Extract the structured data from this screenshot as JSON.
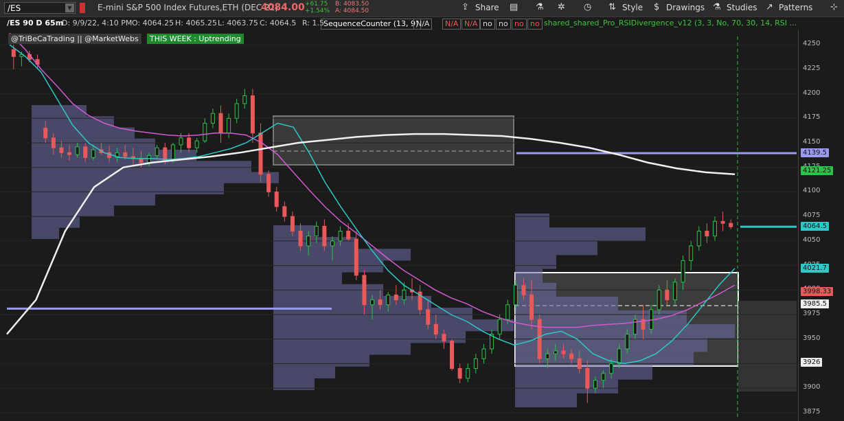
{
  "toolbar": {
    "symbol": "/ES",
    "description": "E-mini S&P 500 Index Futures,ETH (DEC 22)",
    "last_price": "4084.00",
    "change": "+61.75",
    "change_pct": "+1.54%",
    "bid": "B: 4083.50",
    "ask": "A: 4084.50",
    "share_label": "Share",
    "style_label": "Style",
    "drawings_label": "Drawings",
    "studies_label": "Studies",
    "patterns_label": "Patterns"
  },
  "infobar": {
    "period": "/ES 90 D 65m",
    "date": "D: 9/9/22, 4:10 PM",
    "open": "O: 4064.25",
    "high": "H: 4065.25",
    "low": "L: 4063.75",
    "close": "C: 4064.5",
    "range": "R: 1.5",
    "study1": "SequenceCounter (13, 9)",
    "vals": [
      "N/A",
      "N/A",
      "N/A",
      "no",
      "no",
      "no",
      "no"
    ],
    "study2": "shared_shared_Pro_RSIDivergence_v12 (3, 3, No, 70, 30, 14, RSI ..."
  },
  "badges": {
    "handles": "@TriBeCaTrading || @MarketWebs",
    "week": "THIS WEEK : Uptrending"
  },
  "colors": {
    "bg": "#1b1b1b",
    "up": "#2ec24a",
    "down": "#e85a5a",
    "ema_fast": "#2ec8c8",
    "ema_slow": "#d25ad2",
    "sma200": "#f0f0f0",
    "profile": "#6e6ea8",
    "level": "#9a9af0"
  },
  "chart_data": {
    "type": "candlestick",
    "y_ticks": [
      4250,
      4225,
      4200,
      4175,
      4150,
      4125,
      4100,
      4075,
      4050,
      4025,
      4000,
      3975,
      3950,
      3925,
      3900,
      3875
    ],
    "ylim": [
      3870,
      4262
    ],
    "price_labels": [
      {
        "text": "4139.5",
        "value": 4139.5,
        "color": "#9a9af0"
      },
      {
        "text": "4121.25",
        "value": 4121.25,
        "color": "#2ec24a"
      },
      {
        "text": "4064.5",
        "value": 4064.5,
        "color": "#2ec8c8"
      },
      {
        "text": "4021.7",
        "value": 4021.7,
        "color": "#2ec8c8"
      },
      {
        "text": "3998.33",
        "value": 3998.33,
        "color": "#e85a5a"
      },
      {
        "text": "3985.5",
        "value": 3985.5,
        "color": "#eeeeee"
      },
      {
        "text": "3926",
        "value": 3926,
        "color": "#eeeeee"
      }
    ],
    "candles": [
      [
        4245,
        4250,
        4225,
        4238
      ],
      [
        4238,
        4243,
        4228,
        4240
      ],
      [
        4240,
        4244,
        4232,
        4235
      ],
      [
        4235,
        4240,
        4225,
        4230
      ],
      [
        4165,
        4172,
        4150,
        4155
      ],
      [
        4155,
        4160,
        4138,
        4145
      ],
      [
        4145,
        4152,
        4135,
        4140
      ],
      [
        4140,
        4148,
        4132,
        4138
      ],
      [
        4138,
        4150,
        4135,
        4146
      ],
      [
        4146,
        4150,
        4130,
        4135
      ],
      [
        4135,
        4148,
        4132,
        4143
      ],
      [
        4143,
        4150,
        4138,
        4140
      ],
      [
        4140,
        4147,
        4130,
        4135
      ],
      [
        4135,
        4145,
        4130,
        4140
      ],
      [
        4140,
        4148,
        4133,
        4136
      ],
      [
        4136,
        4145,
        4128,
        4134
      ],
      [
        4134,
        4142,
        4125,
        4130
      ],
      [
        4130,
        4140,
        4126,
        4137
      ],
      [
        4137,
        4148,
        4134,
        4145
      ],
      [
        4145,
        4150,
        4128,
        4132
      ],
      [
        4132,
        4150,
        4130,
        4148
      ],
      [
        4148,
        4160,
        4140,
        4155
      ],
      [
        4155,
        4160,
        4140,
        4145
      ],
      [
        4145,
        4155,
        4140,
        4152
      ],
      [
        4152,
        4175,
        4150,
        4170
      ],
      [
        4170,
        4185,
        4165,
        4180
      ],
      [
        4180,
        4188,
        4150,
        4160
      ],
      [
        4160,
        4180,
        4155,
        4175
      ],
      [
        4175,
        4195,
        4170,
        4190
      ],
      [
        4190,
        4205,
        4185,
        4198
      ],
      [
        4198,
        4205,
        4150,
        4160
      ],
      [
        4160,
        4170,
        4110,
        4118
      ],
      [
        4118,
        4122,
        4095,
        4100
      ],
      [
        4100,
        4105,
        4080,
        4085
      ],
      [
        4085,
        4090,
        4070,
        4075
      ],
      [
        4075,
        4080,
        4055,
        4060
      ],
      [
        4060,
        4068,
        4040,
        4045
      ],
      [
        4045,
        4060,
        4035,
        4055
      ],
      [
        4055,
        4070,
        4048,
        4065
      ],
      [
        4065,
        4072,
        4040,
        4045
      ],
      [
        4045,
        4055,
        4030,
        4050
      ],
      [
        4050,
        4065,
        4045,
        4060
      ],
      [
        4060,
        4068,
        4050,
        4052
      ],
      [
        4052,
        4060,
        4010,
        4015
      ],
      [
        4015,
        4020,
        3975,
        3985
      ],
      [
        3985,
        3995,
        3970,
        3990
      ],
      [
        3990,
        4000,
        3980,
        3985
      ],
      [
        3985,
        3998,
        3978,
        3995
      ],
      [
        3995,
        4005,
        3985,
        3990
      ],
      [
        3990,
        4008,
        3985,
        4000
      ],
      [
        4000,
        4012,
        3990,
        3998
      ],
      [
        3998,
        4005,
        3975,
        3980
      ],
      [
        3980,
        3990,
        3960,
        3965
      ],
      [
        3965,
        3975,
        3950,
        3955
      ],
      [
        3955,
        3960,
        3940,
        3948
      ],
      [
        3948,
        3950,
        3918,
        3920
      ],
      [
        3920,
        3925,
        3905,
        3910
      ],
      [
        3910,
        3925,
        3906,
        3920
      ],
      [
        3920,
        3935,
        3915,
        3930
      ],
      [
        3930,
        3945,
        3925,
        3940
      ],
      [
        3940,
        3960,
        3935,
        3955
      ],
      [
        3955,
        3975,
        3950,
        3970
      ],
      [
        3970,
        3990,
        3965,
        3985
      ],
      [
        3985,
        4010,
        3980,
        4005
      ],
      [
        4005,
        4012,
        3990,
        3995
      ],
      [
        3995,
        4010,
        3960,
        3970
      ],
      [
        3970,
        3975,
        3925,
        3930
      ],
      [
        3930,
        3940,
        3920,
        3935
      ],
      [
        3935,
        3945,
        3928,
        3938
      ],
      [
        3938,
        3945,
        3930,
        3935
      ],
      [
        3935,
        3940,
        3925,
        3930
      ],
      [
        3930,
        3938,
        3915,
        3920
      ],
      [
        3920,
        3928,
        3885,
        3900
      ],
      [
        3900,
        3912,
        3895,
        3908
      ],
      [
        3908,
        3918,
        3900,
        3915
      ],
      [
        3915,
        3930,
        3910,
        3925
      ],
      [
        3925,
        3945,
        3920,
        3940
      ],
      [
        3940,
        3960,
        3935,
        3955
      ],
      [
        3955,
        3975,
        3950,
        3970
      ],
      [
        3970,
        3985,
        3950,
        3960
      ],
      [
        3960,
        3985,
        3955,
        3980
      ],
      [
        3980,
        4005,
        3975,
        4000
      ],
      [
        4000,
        4010,
        3985,
        3990
      ],
      [
        3990,
        4012,
        3985,
        4008
      ],
      [
        4008,
        4035,
        4000,
        4030
      ],
      [
        4030,
        4050,
        4020,
        4045
      ],
      [
        4045,
        4065,
        4040,
        4060
      ],
      [
        4060,
        4068,
        4048,
        4055
      ],
      [
        4055,
        4075,
        4050,
        4070
      ],
      [
        4070,
        4080,
        4060,
        4068
      ],
      [
        4068,
        4072,
        4062,
        4064.5
      ]
    ],
    "ema_fast": [
      4250,
      4238,
      4222,
      4195,
      4168,
      4150,
      4140,
      4135,
      4134,
      4134,
      4133,
      4134,
      4136,
      4140,
      4144,
      4150,
      4160,
      4170,
      4166,
      4140,
      4110,
      4085,
      4062,
      4040,
      4020,
      4005,
      3995,
      3985,
      3975,
      3968,
      3958,
      3950,
      3944,
      3948,
      3955,
      3958,
      3950,
      3935,
      3928,
      3925,
      3928,
      3935,
      3948,
      3965,
      3985,
      4005,
      4022
    ],
    "ema_slow": [
      4262,
      4245,
      4225,
      4208,
      4190,
      4178,
      4170,
      4165,
      4162,
      4160,
      4158,
      4157,
      4158,
      4160,
      4160,
      4158,
      4150,
      4138,
      4120,
      4102,
      4085,
      4070,
      4058,
      4045,
      4032,
      4020,
      4010,
      4000,
      3992,
      3986,
      3978,
      3972,
      3967,
      3964,
      3962,
      3962,
      3962,
      3964,
      3965,
      3966,
      3968,
      3970,
      3974,
      3980,
      3988,
      3996,
      4005
    ],
    "sma200": [
      3955,
      3990,
      4060,
      4105,
      4125,
      4130,
      4133,
      4136,
      4140,
      4145,
      4150,
      4153,
      4156,
      4158,
      4159,
      4159,
      4158,
      4157,
      4154,
      4150,
      4145,
      4138,
      4130,
      4124,
      4120,
      4118
    ]
  }
}
